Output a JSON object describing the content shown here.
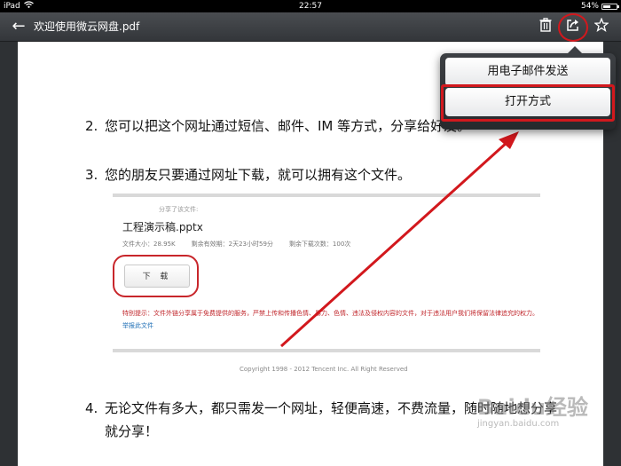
{
  "status_bar": {
    "device": "iPad",
    "time": "22:57",
    "battery": "54%"
  },
  "toolbar": {
    "back_glyph": "←",
    "title": "欢迎使用微云网盘.pdf"
  },
  "popover": {
    "items": [
      "用电子邮件发送",
      "打开方式"
    ]
  },
  "document": {
    "items": [
      {
        "num": "2.",
        "text": "您可以把这个网址通过短信、邮件、IM 等方式，分享给好友。"
      },
      {
        "num": "3.",
        "text": "您的朋友只要通过网址下载，就可以拥有这个文件。"
      },
      {
        "num": "4.",
        "text": "无论文件有多大，都只需发一个网址，轻便高速，不费流量，随时随地想分享",
        "continuation": "就分享！"
      }
    ],
    "screenshot": {
      "share_to": "分享了该文件:",
      "file_name": "工程演示稿.pptx",
      "meta": [
        "文件大小：28.95K",
        "剩余有效期：2天23小时59分",
        "剩余下载次数：100次"
      ],
      "download_label": "下 载",
      "notice": "特别提示：文件外链分享属于免费提供的服务，严禁上传和传播色情、暴力、色情、违法及侵权内容的文件，对于违法用户我们将保留法律追究的权力。",
      "notice_link": "举报此文件",
      "copyright": "Copyright 1998 - 2012 Tencent Inc. All Right Reserved"
    }
  },
  "watermark": {
    "brand": "Baidu经验",
    "url": "jingyan.baidu.com"
  },
  "colors": {
    "annotation_red": "#d2181d"
  },
  "icons": [
    "back-arrow-icon",
    "trash-icon",
    "share-icon",
    "star-icon",
    "wifi-icon",
    "battery-icon"
  ]
}
